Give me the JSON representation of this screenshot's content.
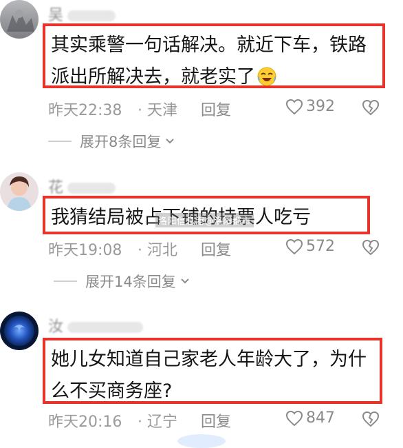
{
  "comments": [
    {
      "username": "吴",
      "content": "其实乘警一句话解决。就近下车，铁路派出所解决去，就老实了",
      "emoji_icon": "laughing-tears-icon",
      "time": "昨天22:38",
      "location": "天津",
      "reply_label": "回复",
      "likes": "392",
      "expand_label": "展开8条回复"
    },
    {
      "username": "花",
      "content": "我猜结局被占下铺的持票人吃亏",
      "time": "昨天19:08",
      "location": "河北",
      "reply_label": "回复",
      "likes": "572",
      "expand_label": "展开14条回复"
    },
    {
      "username": "汝",
      "content": "她儿女知道自己家老人年龄大了，为什么不买商务座?",
      "time": "昨天20:16",
      "location": "辽宁",
      "reply_label": "回复",
      "likes": "847"
    }
  ],
  "watermark": "洛阳信息港@洛阳都市",
  "colors": {
    "highlight_border": "#e8332a",
    "meta_text": "#9a9a9a"
  },
  "icons": {
    "like": "heart-outline-icon",
    "dislike": "broken-heart-icon",
    "expand": "chevron-down-icon"
  }
}
